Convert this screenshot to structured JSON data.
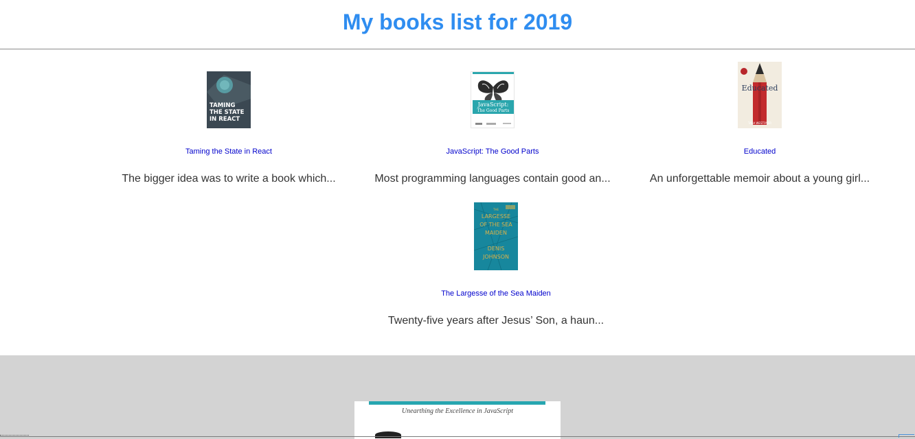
{
  "header": {
    "title": "My books list for 2019"
  },
  "books": [
    {
      "title": "Taming the State in React",
      "description": "The bigger idea was to write a book which...",
      "cover": {
        "text": "TAMING THE STATE IN REACT",
        "color": "#3a4a55",
        "accent": "#4fb3b5"
      }
    },
    {
      "title": "JavaScript: The Good Parts",
      "description": "Most programming languages contain good an...",
      "cover": {
        "text": "JavaScript: The Good Parts",
        "color": "#ffffff",
        "accent": "#2aa6ad"
      }
    },
    {
      "title": "Educated",
      "description": "An unforgettable memoir about a young girl...",
      "cover": {
        "text": "Educated",
        "color": "#f2ece0",
        "accent": "#c0282b"
      }
    },
    {
      "title": "The Largesse of the Sea Maiden",
      "description": "Twenty-five years after Jesus’ Son, a haun...",
      "cover": {
        "text": "THE LARGESSE OF THE SEA MAIDEN DENIS JOHNSON",
        "color": "#1a8aa0",
        "accent": "#d9b24a"
      }
    }
  ],
  "preview": {
    "subtitle": "Unearthing the Excellence in JavaScript"
  },
  "colors": {
    "title": "#2f8df0",
    "link": "#0000cc",
    "panel": "#d3d3d3"
  }
}
